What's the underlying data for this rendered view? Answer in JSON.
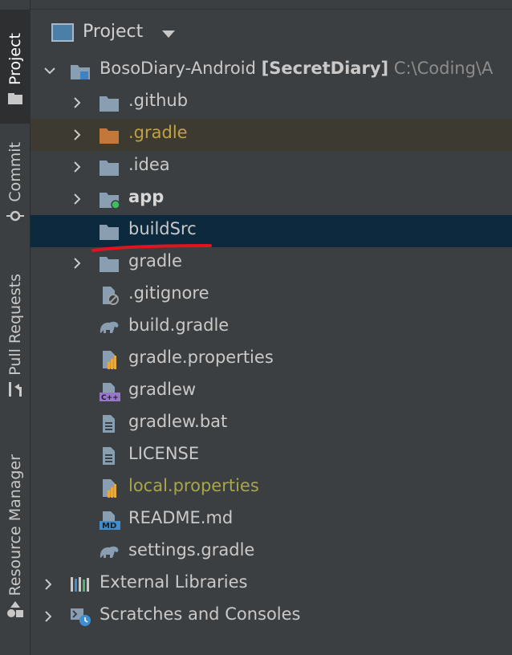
{
  "sidebar": {
    "tabs": [
      {
        "label": "Project",
        "active": true
      },
      {
        "label": "Commit",
        "active": false
      },
      {
        "label": "Pull Requests",
        "active": false
      },
      {
        "label": "Resource Manager",
        "active": false
      }
    ]
  },
  "header": {
    "title": "Project"
  },
  "tree": {
    "root": {
      "name": "BosoDiary-Android",
      "module": "[SecretDiary]",
      "path": "C:\\Coding\\A"
    },
    "items": [
      {
        "label": ".github"
      },
      {
        "label": ".gradle"
      },
      {
        "label": ".idea"
      },
      {
        "label": "app"
      },
      {
        "label": "buildSrc"
      },
      {
        "label": "gradle"
      },
      {
        "label": ".gitignore"
      },
      {
        "label": "build.gradle"
      },
      {
        "label": "gradle.properties"
      },
      {
        "label": "gradlew"
      },
      {
        "label": "gradlew.bat"
      },
      {
        "label": "LICENSE"
      },
      {
        "label": "local.properties"
      },
      {
        "label": "README.md"
      },
      {
        "label": "settings.gradle"
      }
    ],
    "external_libraries": "External Libraries",
    "scratches": "Scratches and Consoles",
    "icon_badges": {
      "cpp": "C++",
      "md": "MD"
    }
  },
  "colors": {
    "background": "#3c3f41",
    "selected_row": "#0d293e",
    "excluded_folder": "#c4773b",
    "annotation": "#e0141e"
  }
}
